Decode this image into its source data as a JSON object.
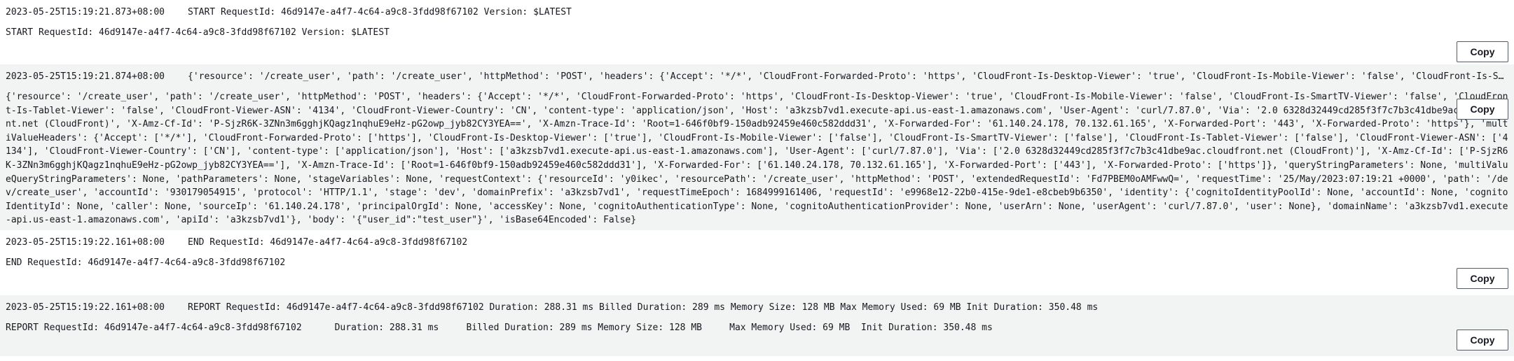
{
  "copy_label": "Copy",
  "entries": [
    {
      "timestamp": "2023-05-25T15:19:21.873+08:00",
      "summary": "START RequestId: 46d9147e-a4f7-4c64-a9c8-3fdd98f67102 Version: $LATEST",
      "detail": "START RequestId: 46d9147e-a4f7-4c64-a9c8-3fdd98f67102 Version: $LATEST"
    },
    {
      "timestamp": "2023-05-25T15:19:21.874+08:00",
      "summary": "{'resource': '/create_user', 'path': '/create_user', 'httpMethod': 'POST', 'headers': {'Accept': '*/*', 'CloudFront-Forwarded-Proto': 'https', 'CloudFront-Is-Desktop-Viewer': 'true', 'CloudFront-Is-Mobile-Viewer': 'false', 'CloudFront-Is-SmartTV-Viewer': 'fal…",
      "detail": "{'resource': '/create_user', 'path': '/create_user', 'httpMethod': 'POST', 'headers': {'Accept': '*/*', 'CloudFront-Forwarded-Proto': 'https', 'CloudFront-Is-Desktop-Viewer': 'true', 'CloudFront-Is-Mobile-Viewer': 'false', 'CloudFront-Is-SmartTV-Viewer': 'false', 'CloudFront-Is-Tablet-Viewer': 'false', 'CloudFront-Viewer-ASN': '4134', 'CloudFront-Viewer-Country': 'CN', 'content-type': 'application/json', 'Host': 'a3kzsb7vd1.execute-api.us-east-1.amazonaws.com', 'User-Agent': 'curl/7.87.0', 'Via': '2.0 6328d32449cd285f3f7c7b3c41dbe9ac.cloudfront.net (CloudFront)', 'X-Amz-Cf-Id': 'P-SjzR6K-3ZNn3m6gghjKQagz1nqhuE9eHz-pG2owp_jyb82CY3YEA==', 'X-Amzn-Trace-Id': 'Root=1-646f0bf9-150adb92459e460c582ddd31', 'X-Forwarded-For': '61.140.24.178, 70.132.61.165', 'X-Forwarded-Port': '443', 'X-Forwarded-Proto': 'https'}, 'multiValueHeaders': {'Accept': ['*/*'], 'CloudFront-Forwarded-Proto': ['https'], 'CloudFront-Is-Desktop-Viewer': ['true'], 'CloudFront-Is-Mobile-Viewer': ['false'], 'CloudFront-Is-SmartTV-Viewer': ['false'], 'CloudFront-Is-Tablet-Viewer': ['false'], 'CloudFront-Viewer-ASN': ['4134'], 'CloudFront-Viewer-Country': ['CN'], 'content-type': ['application/json'], 'Host': ['a3kzsb7vd1.execute-api.us-east-1.amazonaws.com'], 'User-Agent': ['curl/7.87.0'], 'Via': ['2.0 6328d32449cd285f3f7c7b3c41dbe9ac.cloudfront.net (CloudFront)'], 'X-Amz-Cf-Id': ['P-SjzR6K-3ZNn3m6gghjKQagz1nqhuE9eHz-pG2owp_jyb82CY3YEA=='], 'X-Amzn-Trace-Id': ['Root=1-646f0bf9-150adb92459e460c582ddd31'], 'X-Forwarded-For': ['61.140.24.178, 70.132.61.165'], 'X-Forwarded-Port': ['443'], 'X-Forwarded-Proto': ['https']}, 'queryStringParameters': None, 'multiValueQueryStringParameters': None, 'pathParameters': None, 'stageVariables': None, 'requestContext': {'resourceId': 'y0ikec', 'resourcePath': '/create_user', 'httpMethod': 'POST', 'extendedRequestId': 'Fd7PBEM0oAMFwwQ=', 'requestTime': '25/May/2023:07:19:21 +0000', 'path': '/dev/create_user', 'accountId': '930179054915', 'protocol': 'HTTP/1.1', 'stage': 'dev', 'domainPrefix': 'a3kzsb7vd1', 'requestTimeEpoch': 1684999161406, 'requestId': 'e9968e12-22b0-415e-9de1-e8cbeb9b6350', 'identity': {'cognitoIdentityPoolId': None, 'accountId': None, 'cognitoIdentityId': None, 'caller': None, 'sourceIp': '61.140.24.178', 'principalOrgId': None, 'accessKey': None, 'cognitoAuthenticationType': None, 'cognitoAuthenticationProvider': None, 'userArn': None, 'userAgent': 'curl/7.87.0', 'user': None}, 'domainName': 'a3kzsb7vd1.execute-api.us-east-1.amazonaws.com', 'apiId': 'a3kzsb7vd1'}, 'body': '{\"user_id\":\"test_user\"}', 'isBase64Encoded': False}"
    },
    {
      "timestamp": "2023-05-25T15:19:22.161+08:00",
      "summary": "END RequestId: 46d9147e-a4f7-4c64-a9c8-3fdd98f67102",
      "detail": "END RequestId: 46d9147e-a4f7-4c64-a9c8-3fdd98f67102"
    },
    {
      "timestamp": "2023-05-25T15:19:22.161+08:00",
      "summary": "REPORT RequestId: 46d9147e-a4f7-4c64-a9c8-3fdd98f67102 Duration: 288.31 ms Billed Duration: 289 ms Memory Size: 128 MB Max Memory Used: 69 MB Init Duration: 350.48 ms",
      "detail": "REPORT RequestId: 46d9147e-a4f7-4c64-a9c8-3fdd98f67102\tDuration: 288.31 ms\tBilled Duration: 289 ms\tMemory Size: 128 MB\tMax Memory Used: 69 MB\tInit Duration: 350.48 ms"
    }
  ]
}
